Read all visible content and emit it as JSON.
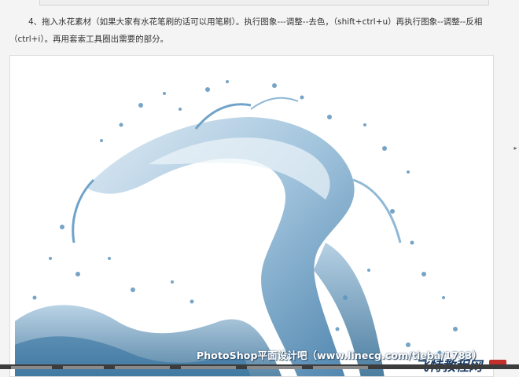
{
  "tutorial": {
    "step_paragraph": "4、拖入水花素材（如果大家有水花笔刷的话可以用笔刷）。执行图象---调整--去色，（shift+ctrl+u）再执行图象--调整--反相（ctrl+i）。再用套索工具圈出需要的部分。"
  },
  "figure": {
    "description_icon": "water-splash-image"
  },
  "watermark": {
    "text": "PhotoShop平面设计吧（www.linecg.com/tieba/1783）"
  },
  "site_logo": {
    "text": "飞特教程网"
  },
  "colors": {
    "water_dark": "#2f6f9f",
    "water_mid": "#6fa3c8",
    "water_light": "#c9dceb",
    "page_bg": "#f4f4f4",
    "logo": "#1d3f66"
  }
}
